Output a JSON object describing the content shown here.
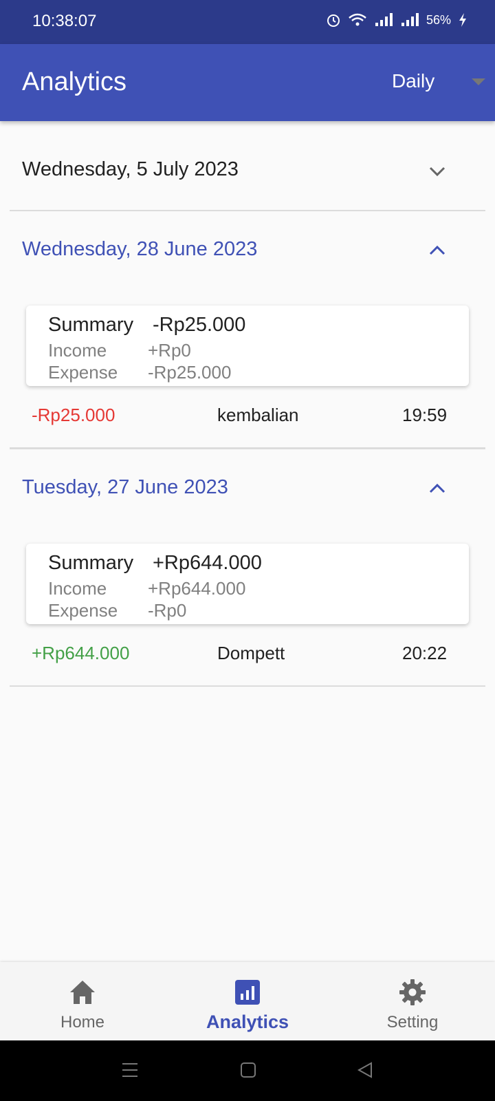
{
  "status_bar": {
    "time": "10:38:07",
    "battery": "56%"
  },
  "app_bar": {
    "title": "Analytics",
    "period": "Daily"
  },
  "days": [
    {
      "date": "Wednesday, 5 July 2023",
      "expanded": false
    },
    {
      "date": "Wednesday, 28 June 2023",
      "expanded": true,
      "summary": {
        "label": "Summary",
        "value": "-Rp25.000",
        "income_label": "Income",
        "income": "+Rp0",
        "expense_label": "Expense",
        "expense": "-Rp25.000"
      },
      "transactions": [
        {
          "amount": "-Rp25.000",
          "name": "kembalian",
          "time": "19:59"
        }
      ]
    },
    {
      "date": "Tuesday, 27 June 2023",
      "expanded": true,
      "summary": {
        "label": "Summary",
        "value": "+Rp644.000",
        "income_label": "Income",
        "income": "+Rp644.000",
        "expense_label": "Expense",
        "expense": "-Rp0"
      },
      "transactions": [
        {
          "amount": "+Rp644.000",
          "name": "Dompett",
          "time": "20:22"
        }
      ]
    }
  ],
  "bottom_nav": [
    {
      "label": "Home",
      "icon": "home-icon"
    },
    {
      "label": "Analytics",
      "icon": "analytics-icon",
      "active": true
    },
    {
      "label": "Setting",
      "icon": "gear-icon"
    }
  ],
  "colors": {
    "primary": "#3f51b5",
    "status_bar": "#2c3a8a",
    "negative": "#e53935",
    "positive": "#43a047"
  }
}
